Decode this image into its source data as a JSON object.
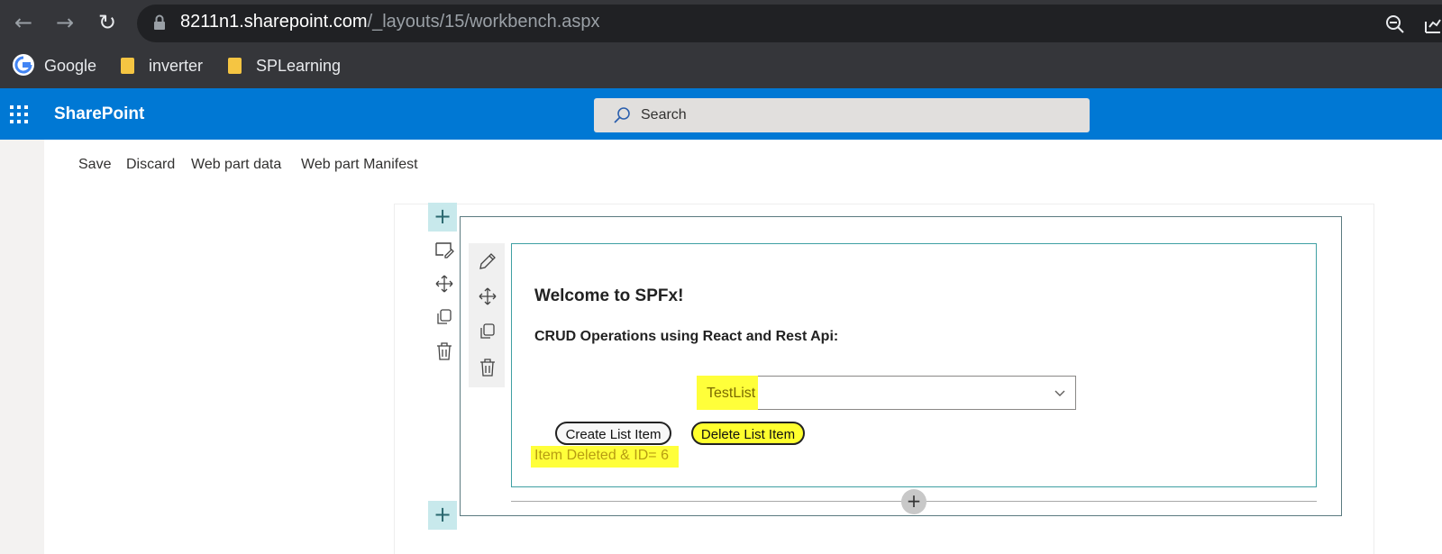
{
  "browser": {
    "url_host": "8211n1.sharepoint.com",
    "url_path": "/_layouts/15/workbench.aspx",
    "bookmarks": [
      {
        "label": "Google"
      },
      {
        "label": "inverter"
      },
      {
        "label": "SPLearning"
      }
    ]
  },
  "suitebar": {
    "brand": "SharePoint",
    "search_placeholder": "Search"
  },
  "commandbar": {
    "items": [
      "Save",
      "Discard",
      "Web part data",
      "Web part Manifest"
    ]
  },
  "webpart": {
    "welcome": "Welcome to SPFx!",
    "crud_title": "CRUD Operations using React and Rest Api:",
    "dropdown_value": "TestList",
    "create_button": "Create List Item",
    "delete_button": "Delete List Item",
    "status": "Item Deleted & ID= 6"
  },
  "colors": {
    "suitebar": "#0078d4",
    "highlight": "#ffff3a",
    "chrome": "#35363a"
  }
}
